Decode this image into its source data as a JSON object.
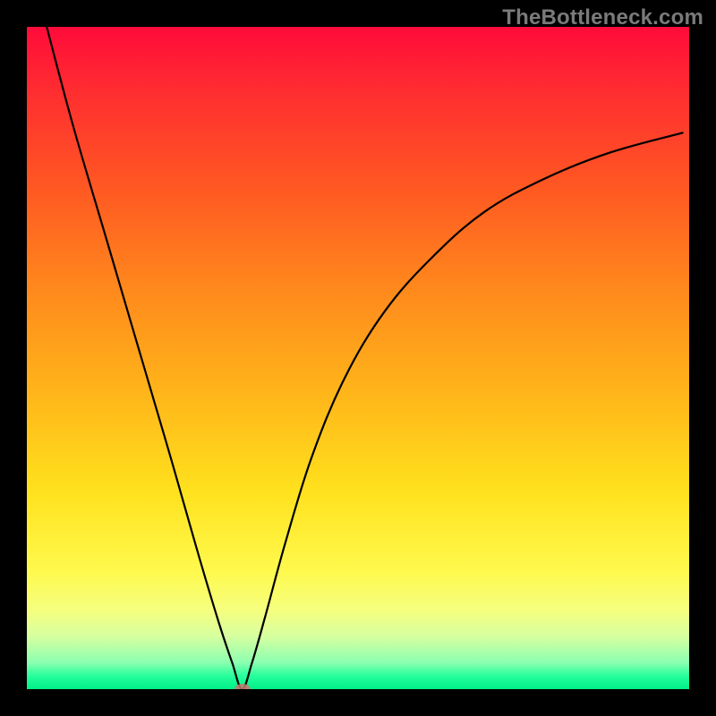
{
  "watermark": {
    "text": "TheBottleneck.com"
  },
  "chart_data": {
    "type": "line",
    "title": "",
    "xlabel": "",
    "ylabel": "",
    "xlim": [
      0,
      100
    ],
    "ylim": [
      0,
      100
    ],
    "grid": false,
    "legend": false,
    "background_gradient": {
      "direction": "vertical",
      "stops": [
        {
          "pos": 0.0,
          "color": "#ff0b3a"
        },
        {
          "pos": 0.25,
          "color": "#ff5a22"
        },
        {
          "pos": 0.55,
          "color": "#ffb41a"
        },
        {
          "pos": 0.82,
          "color": "#fff94c"
        },
        {
          "pos": 0.96,
          "color": "#8bffb0"
        },
        {
          "pos": 1.0,
          "color": "#00ef87"
        }
      ]
    },
    "series": [
      {
        "name": "bottleneck-curve",
        "x": [
          3,
          7,
          12,
          17,
          22,
          26,
          29,
          31,
          32.5,
          34,
          36,
          39,
          43,
          48,
          54,
          61,
          69,
          78,
          88,
          99
        ],
        "y": [
          100,
          85,
          68,
          51,
          34,
          20,
          10,
          4,
          0,
          4,
          11,
          22,
          35,
          47,
          57,
          65,
          72,
          77,
          81,
          84
        ]
      }
    ],
    "markers": [
      {
        "name": "minimum-marker",
        "x": 32.5,
        "y": 0,
        "color": "#c47a6f"
      }
    ]
  }
}
